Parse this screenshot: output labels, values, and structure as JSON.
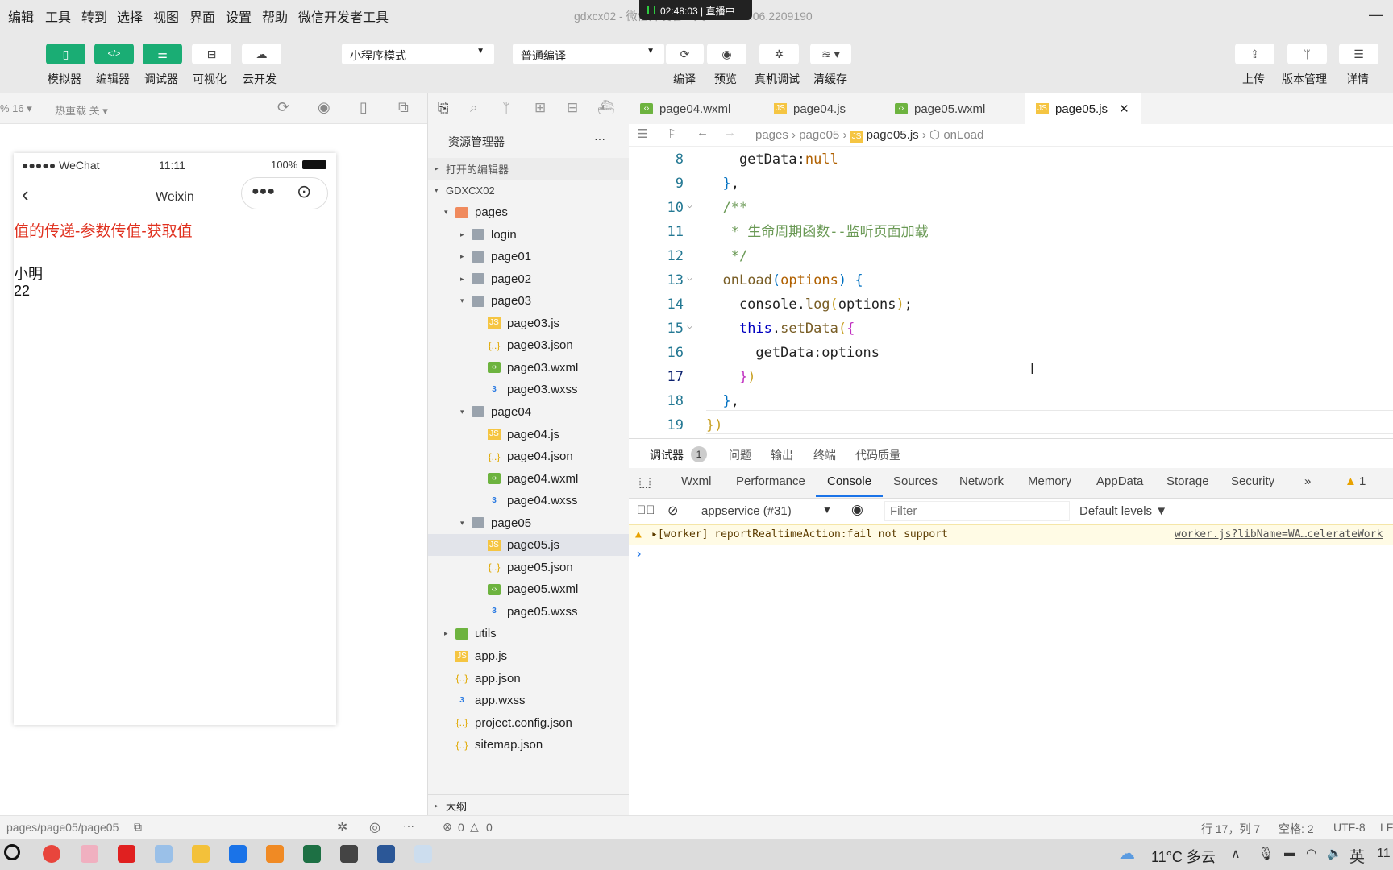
{
  "menubar": {
    "items": [
      "编辑",
      "工具",
      "转到",
      "选择",
      "视图",
      "界面",
      "设置",
      "帮助",
      "微信开发者工具"
    ],
    "window_title": "gdxcx02 - 微信开发者工具 Stable 1.06.2209190",
    "live": {
      "time": "02:48:03",
      "status": "直播中"
    }
  },
  "toolbar": {
    "left": [
      {
        "label": "模拟器",
        "icon": "phone-icon"
      },
      {
        "label": "编辑器",
        "icon": "code-icon"
      },
      {
        "label": "调试器",
        "icon": "sliders-icon"
      },
      {
        "label": "可视化",
        "icon": "layout-icon"
      },
      {
        "label": "云开发",
        "icon": "cloud-icon"
      }
    ],
    "mode_select": "小程序模式",
    "compile_select": "普通编译",
    "mid": [
      {
        "label": "编译",
        "icon": "refresh-icon"
      },
      {
        "label": "预览",
        "icon": "eye-icon"
      },
      {
        "label": "真机调试",
        "icon": "bug-icon"
      },
      {
        "label": "清缓存",
        "icon": "layers-icon"
      }
    ],
    "right": [
      {
        "label": "上传",
        "icon": "upload-icon"
      },
      {
        "label": "版本管理",
        "icon": "branch-icon"
      },
      {
        "label": "详情",
        "icon": "menu-icon"
      }
    ]
  },
  "simulator": {
    "zoom": "% 16 ▾",
    "hot_reload": "热重载 关 ▾",
    "phone": {
      "carrier": "●●●●● WeChat",
      "time": "11:11",
      "battery": "100%",
      "nav_title": "Weixin",
      "heading": "值的传递-参数传值-获取值",
      "heading_color": "#e0301e",
      "name": "小明",
      "age": "22"
    },
    "path": "pages/page05/page05"
  },
  "explorer": {
    "title": "资源管理器",
    "more": "···",
    "open_editors": "打开的编辑器",
    "project": "GDXCX02",
    "outline": "大纲",
    "tree": [
      {
        "label": "pages",
        "type": "folder-open",
        "depth": 1,
        "arrow": "▾"
      },
      {
        "label": "login",
        "type": "folder",
        "depth": 2,
        "arrow": "▸"
      },
      {
        "label": "page01",
        "type": "folder",
        "depth": 2,
        "arrow": "▸"
      },
      {
        "label": "page02",
        "type": "folder",
        "depth": 2,
        "arrow": "▸"
      },
      {
        "label": "page03",
        "type": "folder",
        "depth": 2,
        "arrow": "▾"
      },
      {
        "label": "page03.js",
        "type": "js",
        "depth": 3
      },
      {
        "label": "page03.json",
        "type": "json",
        "depth": 3
      },
      {
        "label": "page03.wxml",
        "type": "wxml",
        "depth": 3
      },
      {
        "label": "page03.wxss",
        "type": "wxss",
        "depth": 3
      },
      {
        "label": "page04",
        "type": "folder",
        "depth": 2,
        "arrow": "▾"
      },
      {
        "label": "page04.js",
        "type": "js",
        "depth": 3
      },
      {
        "label": "page04.json",
        "type": "json",
        "depth": 3
      },
      {
        "label": "page04.wxml",
        "type": "wxml",
        "depth": 3
      },
      {
        "label": "page04.wxss",
        "type": "wxss",
        "depth": 3
      },
      {
        "label": "page05",
        "type": "folder",
        "depth": 2,
        "arrow": "▾"
      },
      {
        "label": "page05.js",
        "type": "js",
        "depth": 3,
        "selected": true
      },
      {
        "label": "page05.json",
        "type": "json",
        "depth": 3
      },
      {
        "label": "page05.wxml",
        "type": "wxml",
        "depth": 3
      },
      {
        "label": "page05.wxss",
        "type": "wxss",
        "depth": 3
      },
      {
        "label": "utils",
        "type": "folder",
        "depth": 1,
        "arrow": "▸"
      },
      {
        "label": "app.js",
        "type": "js",
        "depth": 1
      },
      {
        "label": "app.json",
        "type": "json",
        "depth": 1
      },
      {
        "label": "app.wxss",
        "type": "wxss",
        "depth": 1
      },
      {
        "label": "project.config.json",
        "type": "json",
        "depth": 1
      },
      {
        "label": "sitemap.json",
        "type": "json",
        "depth": 1
      }
    ]
  },
  "editor": {
    "tabs": [
      {
        "label": "page04.wxml",
        "type": "wxml"
      },
      {
        "label": "page04.js",
        "type": "js"
      },
      {
        "label": "page05.wxml",
        "type": "wxml"
      },
      {
        "label": "page05.js",
        "type": "js",
        "active": true
      }
    ],
    "breadcrumb": [
      "pages",
      "page05",
      "page05.js",
      "onLoad"
    ],
    "lines": [
      {
        "n": "8",
        "html": "    getData:<span class='n'>null</span>"
      },
      {
        "n": "9",
        "html": "  <span class='b'>}</span>,"
      },
      {
        "n": "10",
        "html": "  <span class='c'>/**</span>",
        "fold": true
      },
      {
        "n": "11",
        "html": "   <span class='c'>* 生命周期函数--监听页面加载</span>"
      },
      {
        "n": "12",
        "html": "   <span class='c'>*/</span>"
      },
      {
        "n": "13",
        "html": "  <span class='k'>onLoad</span><span class='b'>(</span><span class='n'>options</span><span class='b'>)</span> <span class='b'>{</span>",
        "fold": true
      },
      {
        "n": "14",
        "html": "    console.<span class='k'>log</span><span class='y'>(</span>options<span class='y'>)</span>;"
      },
      {
        "n": "15",
        "html": "    <span class='kw'>this</span>.<span class='k'>setData</span><span class='y'>(</span><span class='m'>{</span>",
        "fold": true
      },
      {
        "n": "16",
        "html": "      getData:options"
      },
      {
        "n": "17",
        "html": "    <span class='m'>}</span><span class='y'>)</span>"
      },
      {
        "n": "18",
        "html": "  <span class='b'>}</span>,"
      },
      {
        "n": "19",
        "html": "<span class='y'>})</span>"
      }
    ]
  },
  "debugger": {
    "tabs": [
      "调试器",
      "问题",
      "输出",
      "终端",
      "代码质量"
    ],
    "badge": "1",
    "devtools_tabs": [
      "Wxml",
      "Performance",
      "Console",
      "Sources",
      "Network",
      "Memory",
      "AppData",
      "Storage",
      "Security",
      "»"
    ],
    "warnings": "1",
    "context": "appservice (#31)",
    "filter_placeholder": "Filter",
    "levels": "Default levels ▼",
    "message": "▸[worker] reportRealtimeAction:fail not support",
    "source": "worker.js?libName=WA…celerateWork",
    "prompt": "›"
  },
  "statusbar": {
    "errors": "0",
    "warnings": "0",
    "position": "行 17，列 7",
    "indent": "空格: 2",
    "encoding": "UTF-8",
    "eol": "LF"
  },
  "taskbar": {
    "weather": "11°C 多云",
    "ime": "英",
    "clock": "11"
  }
}
